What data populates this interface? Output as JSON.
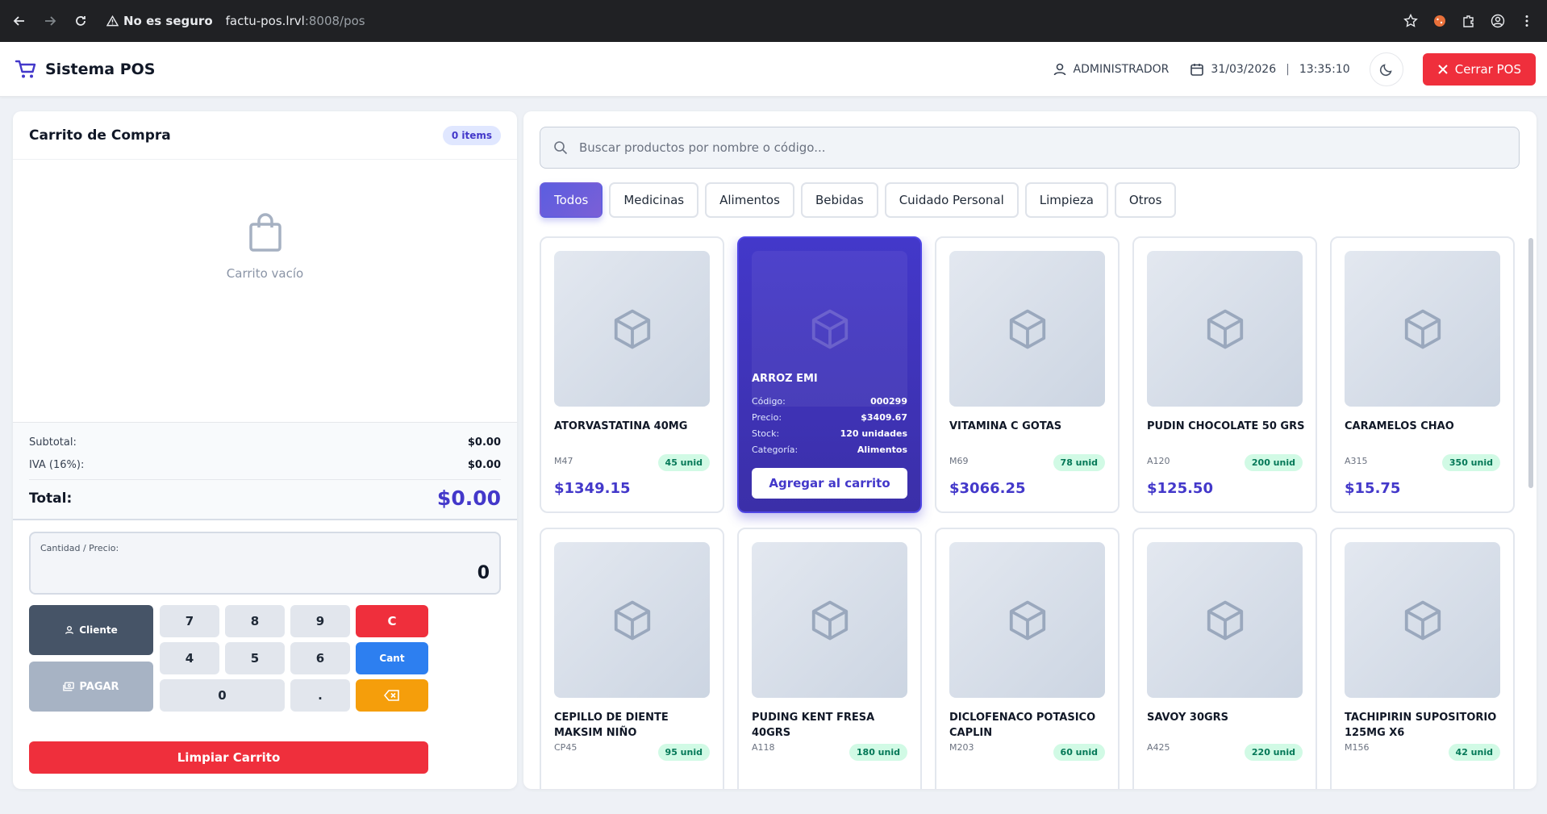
{
  "browser": {
    "security_label": "No es seguro",
    "url_host": "factu-pos.lrvl",
    "url_path": ":8008/pos"
  },
  "header": {
    "title": "Sistema POS",
    "user": "ADMINISTRADOR",
    "date": "31/03/2026",
    "date_sep": "|",
    "time": "13:35:10",
    "logout_label": "Cerrar POS"
  },
  "cart": {
    "title": "Carrito de Compra",
    "items_badge": "0 items",
    "empty_text": "Carrito vacío",
    "subtotal_label": "Subtotal:",
    "subtotal_value": "$0.00",
    "iva_label": "IVA (16%):",
    "iva_value": "$0.00",
    "total_label": "Total:",
    "total_value": "$0.00"
  },
  "keypad": {
    "display_label": "Cantidad / Precio:",
    "display_value": "0",
    "client_label": "Cliente",
    "pay_label": "PAGAR",
    "k7": "7",
    "k8": "8",
    "k9": "9",
    "k4": "4",
    "k5": "5",
    "k6": "6",
    "k0": "0",
    "kdot": ".",
    "clear_label": "C",
    "cant_label": "Cant",
    "clear_cart_label": "Limpiar Carrito"
  },
  "search": {
    "placeholder": "Buscar productos por nombre o código..."
  },
  "categories": [
    {
      "label": "Todos",
      "active": true
    },
    {
      "label": "Medicinas"
    },
    {
      "label": "Alimentos"
    },
    {
      "label": "Bebidas"
    },
    {
      "label": "Cuidado Personal"
    },
    {
      "label": "Limpieza"
    },
    {
      "label": "Otros"
    }
  ],
  "products": [
    {
      "name": "ATORVASTATINA 40MG",
      "code": "M47",
      "stock": "45 unid",
      "price": "$1349.15"
    },
    {
      "name": "ARROZ EMI",
      "code": "000299",
      "stock": "120 unidades",
      "price": "$3409.67",
      "category": "Alimentos",
      "hovered": true
    },
    {
      "name": "VITAMINA C GOTAS",
      "code": "M69",
      "stock": "78 unid",
      "price": "$3066.25"
    },
    {
      "name": "PUDIN CHOCOLATE 50 GRS",
      "code": "A120",
      "stock": "200 unid",
      "price": "$125.50"
    },
    {
      "name": "CARAMELOS CHAO",
      "code": "A315",
      "stock": "350 unid",
      "price": "$15.75"
    },
    {
      "name": "CEPILLO DE DIENTE MAKSIM NIÑO",
      "code": "CP45",
      "stock": "95 unid"
    },
    {
      "name": "PUDING KENT FRESA 40GRS",
      "code": "A118",
      "stock": "180 unid"
    },
    {
      "name": "DICLOFENACO POTASICO CAPLIN",
      "code": "M203",
      "stock": "60 unid"
    },
    {
      "name": "SAVOY 30GRS",
      "code": "A425",
      "stock": "220 unid"
    },
    {
      "name": "TACHIPIRIN SUPOSITORIO 125MG X6",
      "code": "M156",
      "stock": "42 unid"
    }
  ],
  "hover_card": {
    "code_label": "Código:",
    "price_label": "Precio:",
    "stock_label": "Stock:",
    "category_label": "Categoría:",
    "add_label": "Agregar al carrito"
  },
  "colors": {
    "accent": "#4338ca",
    "danger": "#ef2f3c",
    "info": "#2d7ff0",
    "warning": "#f59e0b",
    "stock_bg": "#d1fae5",
    "stock_text": "#047857"
  },
  "icons": {
    "brand": "cart-icon",
    "user": "user-icon",
    "date": "calendar-icon",
    "theme": "moon-icon",
    "logout": "close-icon",
    "empty_cart": "shopping-bag-icon",
    "search": "search-icon",
    "product": "box-icon",
    "backspace": "backspace-icon"
  }
}
